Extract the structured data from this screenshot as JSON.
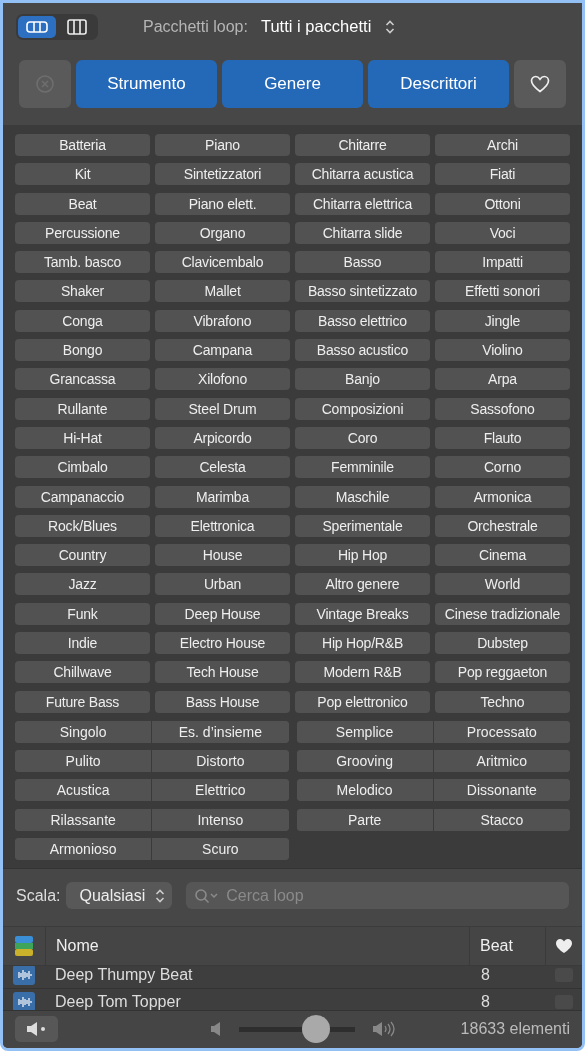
{
  "view_toggle": [
    {
      "kind": "buttons",
      "selected": true
    },
    {
      "kind": "columns",
      "selected": false
    }
  ],
  "loop_packs": {
    "label": "Pacchetti loop:",
    "value": "Tutti i pacchetti"
  },
  "categories": [
    {
      "label": "Strumento",
      "selected": true
    },
    {
      "label": "Genere",
      "selected": true
    },
    {
      "label": "Descrittori",
      "selected": true
    }
  ],
  "keywords": [
    {
      "label": "Batteria",
      "selected": false
    },
    {
      "label": "Piano",
      "selected": false
    },
    {
      "label": "Chitarre",
      "selected": false
    },
    {
      "label": "Archi",
      "selected": false
    },
    {
      "label": "Kit",
      "selected": false
    },
    {
      "label": "Sintetizzatori",
      "selected": false
    },
    {
      "label": "Chitarra acustica",
      "selected": false
    },
    {
      "label": "Fiati",
      "selected": false
    },
    {
      "label": "Beat",
      "selected": false
    },
    {
      "label": "Piano elett.",
      "selected": false
    },
    {
      "label": "Chitarra elettrica",
      "selected": false
    },
    {
      "label": "Ottoni",
      "selected": false
    },
    {
      "label": "Percussione",
      "selected": false
    },
    {
      "label": "Organo",
      "selected": false
    },
    {
      "label": "Chitarra slide",
      "selected": false
    },
    {
      "label": "Voci",
      "selected": false
    },
    {
      "label": "Tamb. basco",
      "selected": false
    },
    {
      "label": "Clavicembalo",
      "selected": false
    },
    {
      "label": "Basso",
      "selected": false
    },
    {
      "label": "Impatti",
      "selected": false
    },
    {
      "label": "Shaker",
      "selected": false
    },
    {
      "label": "Mallet",
      "selected": false
    },
    {
      "label": "Basso sintetizzato",
      "selected": false
    },
    {
      "label": "Effetti sonori",
      "selected": false
    },
    {
      "label": "Conga",
      "selected": false
    },
    {
      "label": "Vibrafono",
      "selected": false
    },
    {
      "label": "Basso elettrico",
      "selected": false
    },
    {
      "label": "Jingle",
      "selected": false
    },
    {
      "label": "Bongo",
      "selected": false
    },
    {
      "label": "Campana",
      "selected": false
    },
    {
      "label": "Basso acustico",
      "selected": false
    },
    {
      "label": "Violino",
      "selected": false
    },
    {
      "label": "Grancassa",
      "selected": false
    },
    {
      "label": "Xilofono",
      "selected": false
    },
    {
      "label": "Banjo",
      "selected": false
    },
    {
      "label": "Arpa",
      "selected": false
    },
    {
      "label": "Rullante",
      "selected": false
    },
    {
      "label": "Steel Drum",
      "selected": false
    },
    {
      "label": "Composizioni",
      "selected": false
    },
    {
      "label": "Sassofono",
      "selected": false
    },
    {
      "label": "Hi-Hat",
      "selected": false
    },
    {
      "label": "Arpicordo",
      "selected": false
    },
    {
      "label": "Coro",
      "selected": false
    },
    {
      "label": "Flauto",
      "selected": false
    },
    {
      "label": "Cimbalo",
      "selected": false
    },
    {
      "label": "Celesta",
      "selected": false
    },
    {
      "label": "Femminile",
      "selected": false
    },
    {
      "label": "Corno",
      "selected": false
    },
    {
      "label": "Campanaccio",
      "selected": false
    },
    {
      "label": "Marimba",
      "selected": false
    },
    {
      "label": "Maschile",
      "selected": false
    },
    {
      "label": "Armonica",
      "selected": false
    },
    {
      "label": "Rock/Blues",
      "selected": false
    },
    {
      "label": "Elettronica",
      "selected": false
    },
    {
      "label": "Sperimentale",
      "selected": false
    },
    {
      "label": "Orchestrale",
      "selected": false
    },
    {
      "label": "Country",
      "selected": false
    },
    {
      "label": "House",
      "selected": false
    },
    {
      "label": "Hip Hop",
      "selected": false
    },
    {
      "label": "Cinema",
      "selected": false
    },
    {
      "label": "Jazz",
      "selected": false
    },
    {
      "label": "Urban",
      "selected": false
    },
    {
      "label": "Altro genere",
      "selected": false
    },
    {
      "label": "World",
      "selected": false
    },
    {
      "label": "Funk",
      "selected": false
    },
    {
      "label": "Deep House",
      "selected": false
    },
    {
      "label": "Vintage Breaks",
      "selected": false
    },
    {
      "label": "Cinese tradizionale",
      "selected": false
    },
    {
      "label": "Indie",
      "selected": false
    },
    {
      "label": "Electro House",
      "selected": false
    },
    {
      "label": "Hip Hop/R&B",
      "selected": false
    },
    {
      "label": "Dubstep",
      "selected": false
    },
    {
      "label": "Chillwave",
      "selected": false
    },
    {
      "label": "Tech House",
      "selected": false
    },
    {
      "label": "Modern R&B",
      "selected": false
    },
    {
      "label": "Pop reggaeton",
      "selected": false
    },
    {
      "label": "Future Bass",
      "selected": false
    },
    {
      "label": "Bass House",
      "selected": false
    },
    {
      "label": "Pop elettronico",
      "selected": false
    },
    {
      "label": "Techno",
      "selected": false
    }
  ],
  "descriptors": [
    {
      "options": [
        {
          "label": "Singolo",
          "selected": false
        },
        {
          "label": "Es. d’insieme",
          "selected": false
        }
      ]
    },
    {
      "options": [
        {
          "label": "Semplice",
          "selected": false
        },
        {
          "label": "Processato",
          "selected": false
        }
      ]
    },
    {
      "options": [
        {
          "label": "Pulito",
          "selected": false
        },
        {
          "label": "Distorto",
          "selected": false
        }
      ]
    },
    {
      "options": [
        {
          "label": "Grooving",
          "selected": false
        },
        {
          "label": "Aritmico",
          "selected": false
        }
      ]
    },
    {
      "options": [
        {
          "label": "Acustica",
          "selected": false
        },
        {
          "label": "Elettrico",
          "selected": false
        }
      ]
    },
    {
      "options": [
        {
          "label": "Melodico",
          "selected": false
        },
        {
          "label": "Dissonante",
          "selected": false
        }
      ]
    },
    {
      "options": [
        {
          "label": "Rilassante",
          "selected": false
        },
        {
          "label": "Intenso",
          "selected": false
        }
      ]
    },
    {
      "options": [
        {
          "label": "Parte",
          "selected": false
        },
        {
          "label": "Stacco",
          "selected": false
        }
      ]
    },
    {
      "options": [
        {
          "label": "Armonioso",
          "selected": false
        },
        {
          "label": "Scuro",
          "selected": false
        }
      ]
    }
  ],
  "scale": {
    "label": "Scala:",
    "value": "Qualsiasi"
  },
  "search": {
    "placeholder": "Cerca loop"
  },
  "table": {
    "columns": [
      "Nome",
      "Beat"
    ],
    "rows": [
      {
        "name": "Deep Thumpy Beat",
        "beats": "8",
        "favorite": false
      },
      {
        "name": "Deep Tom Topper",
        "beats": "8",
        "favorite": false
      }
    ]
  },
  "volume": {
    "level": 0.66
  },
  "count": "18633 elementi"
}
